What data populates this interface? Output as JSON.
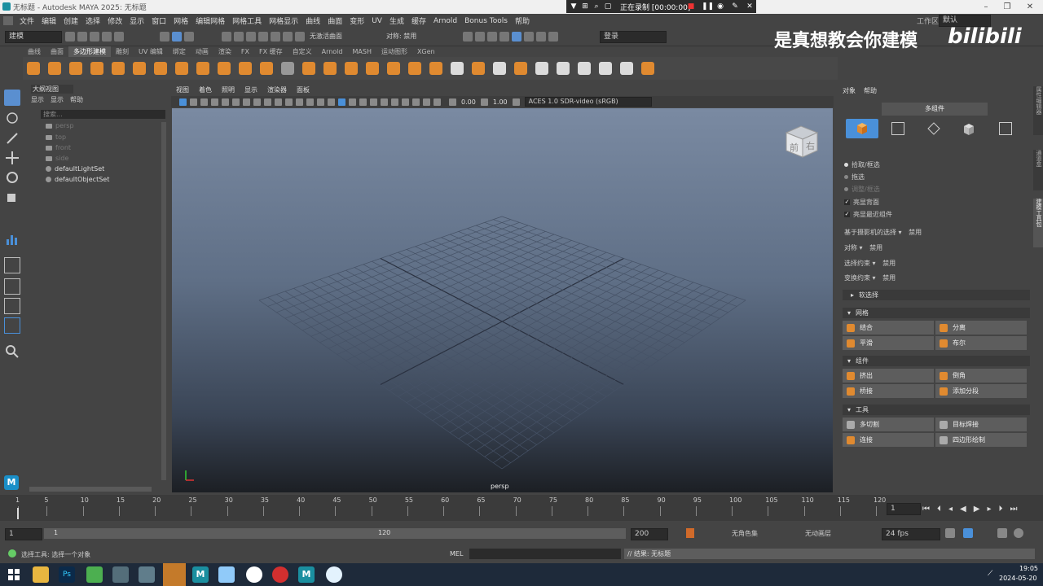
{
  "window": {
    "title": "无标题 - Autodesk MAYA 2025: 无标题"
  },
  "recording": {
    "label": "正在录制 [00:00:00]"
  },
  "menubar": [
    "文件",
    "编辑",
    "创建",
    "选择",
    "修改",
    "显示",
    "窗口",
    "网格",
    "编辑网格",
    "网格工具",
    "网格显示",
    "曲线",
    "曲面",
    "变形",
    "UV",
    "生成",
    "缓存",
    "Arnold",
    "Bonus Tools",
    "帮助"
  ],
  "workspace": {
    "label": "工作区:",
    "value": "默认"
  },
  "statusline": {
    "mode": "建模",
    "surface": "无激活曲面",
    "symmetry": "对称: 禁用",
    "login": "登录"
  },
  "watermark": {
    "text": "是真想教会你建模",
    "logo": "bilibili"
  },
  "shelf_tabs": [
    "曲线",
    "曲面",
    "多边形建模",
    "雕刻",
    "UV 编辑",
    "绑定",
    "动画",
    "渲染",
    "FX",
    "FX 缓存",
    "自定义",
    "Arnold",
    "MASH",
    "运动图形",
    "XGen"
  ],
  "shelf_active": "多边形建模",
  "outliner": {
    "title": "大纲视图",
    "menu": [
      "显示",
      "显示",
      "帮助"
    ],
    "search_placeholder": "搜索...",
    "items": [
      "persp",
      "top",
      "front",
      "side",
      "defaultLightSet",
      "defaultObjectSet"
    ]
  },
  "viewport": {
    "menu": [
      "视图",
      "着色",
      "照明",
      "显示",
      "渲染器",
      "面板"
    ],
    "exposure": "0.00",
    "gamma": "1.00",
    "colorspace": "ACES 1.0 SDR-video (sRGB)",
    "camera": "persp",
    "viewcube_front": "前",
    "viewcube_right": "右"
  },
  "rightpanel": {
    "menu": [
      "对象",
      "帮助"
    ],
    "title": "多组件",
    "options": [
      "拾取/框选",
      "拖选",
      "调整/框选"
    ],
    "checks": [
      "亮显背面",
      "亮显最近组件"
    ],
    "camera_select": "基于摄影机的选择",
    "camera_select_val": "禁用",
    "symmetry": "对称",
    "symmetry_val": "禁用",
    "sel_constraint": "选择约束",
    "sel_constraint_val": "禁用",
    "xform_constraint": "变换约束",
    "xform_constraint_val": "禁用",
    "soft_select": "软选择",
    "sections": [
      {
        "title": "网格",
        "buttons": [
          "结合",
          "分离",
          "平滑",
          "布尔"
        ]
      },
      {
        "title": "组件",
        "buttons": [
          "挤出",
          "倒角",
          "桥接",
          "添加分段"
        ]
      },
      {
        "title": "工具",
        "buttons": [
          "多切割",
          "目标焊接",
          "连接",
          "四边形绘制"
        ]
      }
    ],
    "side_tabs": [
      "建模工具包",
      "属性编辑器",
      "通道盒"
    ]
  },
  "timeline": {
    "ticks": [
      "1",
      "5",
      "10",
      "15",
      "20",
      "25",
      "30",
      "35",
      "40",
      "45",
      "50",
      "55",
      "60",
      "65",
      "70",
      "75",
      "80",
      "85",
      "90",
      "95",
      "100",
      "105",
      "110",
      "115",
      "120"
    ],
    "current": "1",
    "start": "1",
    "range_start": "1",
    "range_end": "120",
    "end": "200",
    "char_set": "无角色集",
    "anim_layer": "无动画层",
    "fps": "24 fps"
  },
  "cmdline": {
    "help": "选择工具: 选择一个对象",
    "lang": "MEL",
    "result": "// 结果: 无标题"
  },
  "taskbar": {
    "time": "19:05",
    "date": "2024-05-20"
  }
}
